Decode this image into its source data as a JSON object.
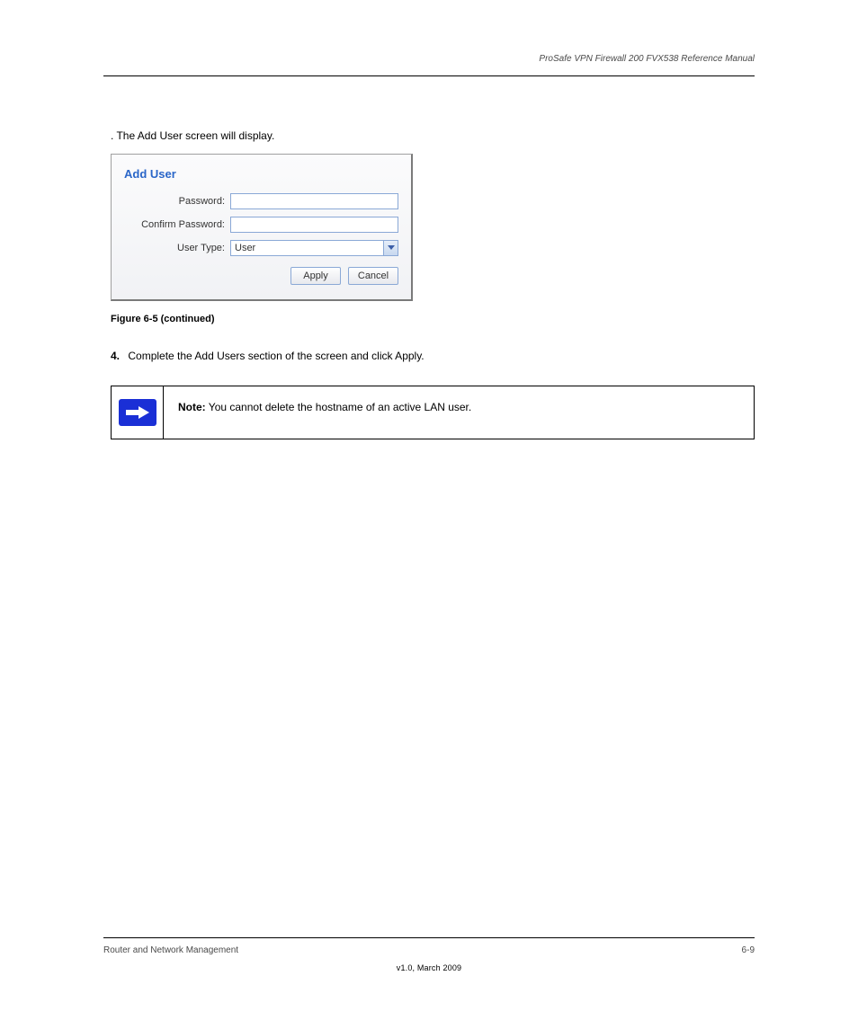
{
  "header": {
    "doc_title": "ProSafe VPN Firewall 200 FVX538 Reference Manual"
  },
  "instr": {
    "line": ". The Add User screen will display."
  },
  "dialog": {
    "title": "Add User",
    "password_label": "Password:",
    "password_value": "",
    "confirm_label": "Confirm Password:",
    "confirm_value": "",
    "usertype_label": "User Type:",
    "usertype_value": "User",
    "apply_label": "Apply",
    "cancel_label": "Cancel"
  },
  "figure": {
    "caption": "Figure 6-5 (continued)"
  },
  "steps": {
    "s4": {
      "num": "4.",
      "text": "Complete the Add Users section of the screen and click Apply."
    }
  },
  "note": {
    "label": "Note:",
    "text": "You cannot delete the hostname of an active LAN user."
  },
  "footer": {
    "left": "Router and Network Management",
    "center": "v1.0, March 2009",
    "right": "6-9"
  }
}
